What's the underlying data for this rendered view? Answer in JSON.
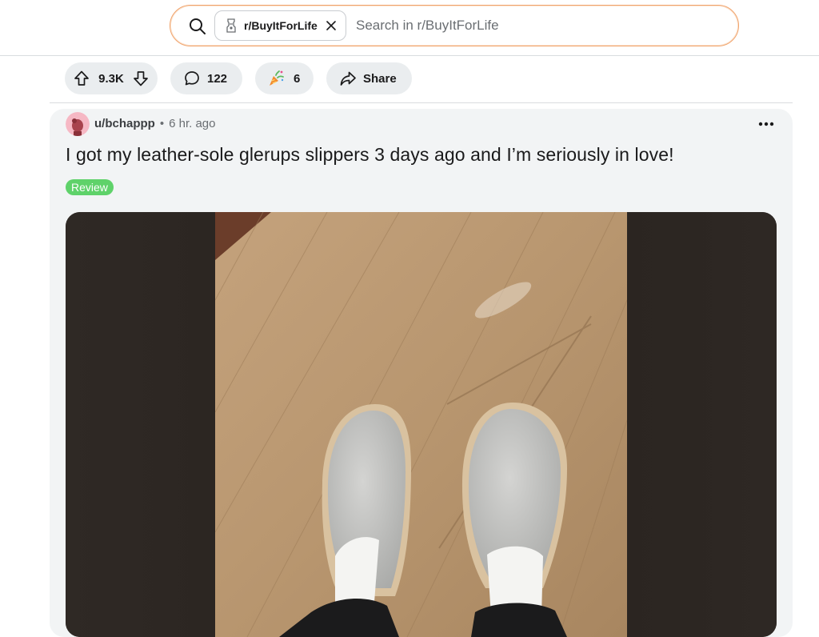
{
  "search": {
    "community_chip": "r/BuyItForLife",
    "placeholder": "Search in r/BuyItForLife"
  },
  "actions": {
    "score": "9.3K",
    "comments": "122",
    "awards": "6",
    "share_label": "Share"
  },
  "post": {
    "author": "u/bchappp",
    "separator": "•",
    "age": "6 hr. ago",
    "title": "I got my leather-sole glerups slippers 3 days ago and I’m seriously in love!",
    "flair": "Review",
    "flair_color": "#5fd26a"
  },
  "icons": {
    "search": "search-icon",
    "community": "community-icon",
    "clear": "close-icon",
    "upvote": "upvote-icon",
    "downvote": "downvote-icon",
    "comment": "comment-icon",
    "award": "award-icon",
    "share": "share-icon",
    "more": "more-options-icon"
  },
  "colors": {
    "search_border": "#f0a26a",
    "pill_bg": "#eaedef",
    "card_bg": "#f2f4f5"
  }
}
